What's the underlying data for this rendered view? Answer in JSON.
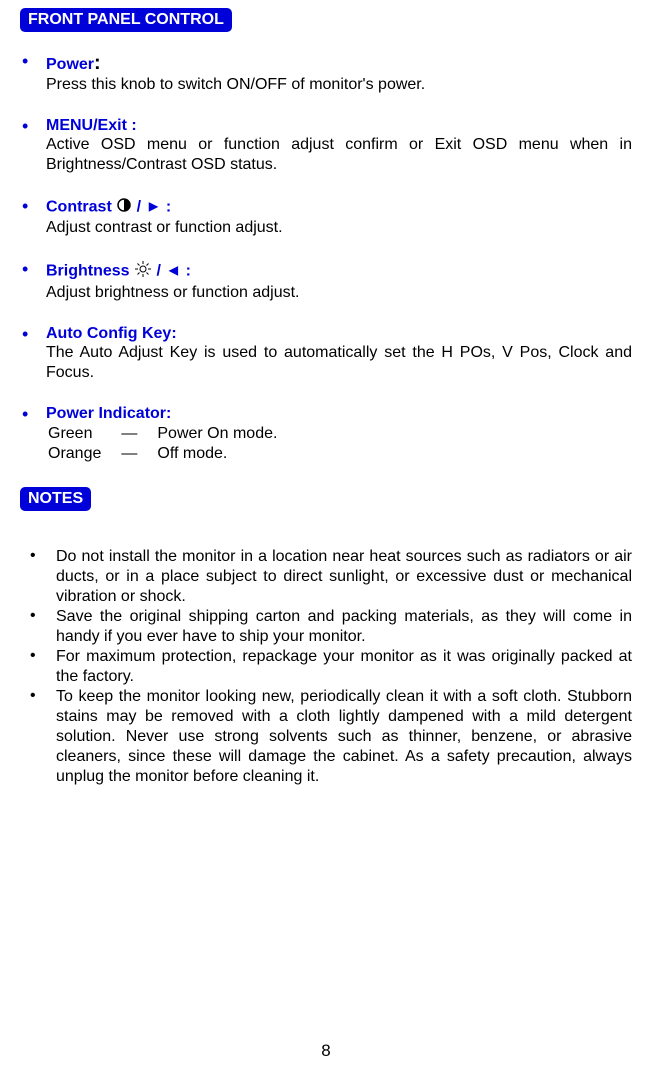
{
  "section1": {
    "title": "FRONT PANEL CONTROL",
    "items": [
      {
        "title": "Power",
        "colon_big": true,
        "desc": "Press this knob to switch ON/OFF of monitor's power."
      },
      {
        "title": "MENU/Exit :",
        "desc": "Active OSD menu or function adjust confirm or Exit OSD menu when in Brightness/Contrast OSD status."
      },
      {
        "title_prefix": "Contrast ",
        "icon": "contrast",
        "title_suffix": " / ► :",
        "desc": "Adjust contrast or function adjust."
      },
      {
        "title_prefix": "Brightness ",
        "icon": "brightness",
        "title_suffix": " / ◄ :",
        "desc": "Adjust brightness or function adjust."
      },
      {
        "title": " Auto Config Key:",
        "desc": "The Auto Adjust Key is used to automatically set the H POs, V Pos, Clock and Focus."
      },
      {
        "title": "Power Indicator:",
        "indicators": [
          {
            "color": "Green",
            "dash": "—",
            "mode": "Power On mode."
          },
          {
            "color": "Orange",
            "dash": "—",
            "mode": "Off mode."
          }
        ]
      }
    ]
  },
  "section2": {
    "title": "NOTES",
    "items": [
      "Do not install the monitor in a location near heat sources such as radiators or air ducts, or in a place subject to direct sunlight, or excessive dust or mechanical vibration or shock.",
      "Save the original shipping carton and packing materials, as they will come in handy if you ever have to ship your monitor.",
      "For maximum protection, repackage your monitor as it was originally packed at the factory.",
      "To keep the monitor looking new, periodically clean it with a soft cloth. Stubborn stains may be removed with a cloth lightly dampened with a mild detergent solution. Never use strong solvents such as thinner, benzene, or abrasive cleaners, since these will damage the cabinet. As a safety precaution, always unplug the monitor before cleaning it."
    ]
  },
  "page_number": "8"
}
